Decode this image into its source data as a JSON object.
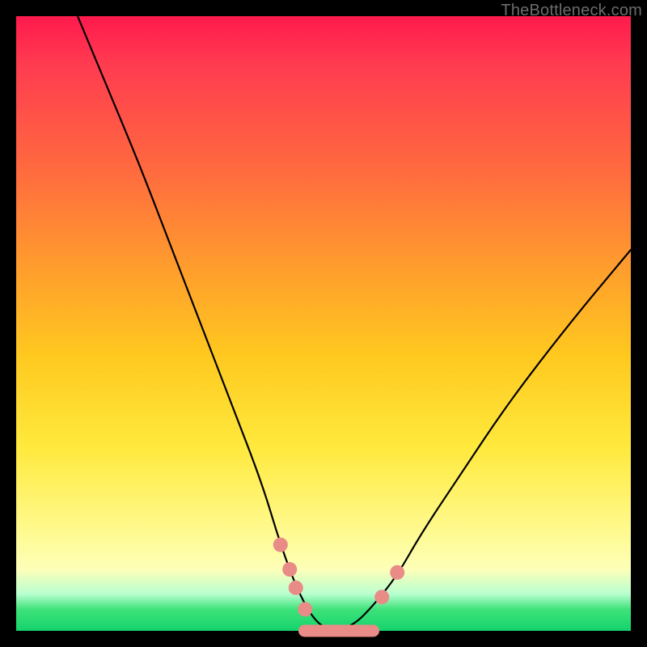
{
  "watermark": "TheBottleneck.com",
  "chart_data": {
    "type": "line",
    "title": "",
    "xlabel": "",
    "ylabel": "",
    "xlim": [
      0,
      100
    ],
    "ylim": [
      0,
      100
    ],
    "series": [
      {
        "name": "bottleneck-curve",
        "x": [
          10,
          15,
          20,
          25,
          30,
          35,
          40,
          43,
          46,
          49,
          52,
          55,
          58,
          62,
          66,
          72,
          80,
          90,
          100
        ],
        "values": [
          100,
          88,
          76,
          63,
          50,
          37,
          24,
          14,
          6,
          1,
          0,
          1,
          4,
          9,
          16,
          25,
          37,
          50,
          62
        ]
      }
    ],
    "markers": [
      {
        "x": 43.0,
        "y": 14.0,
        "shape": "circle"
      },
      {
        "x": 44.5,
        "y": 10.0,
        "shape": "circle"
      },
      {
        "x": 45.5,
        "y": 7.0,
        "shape": "circle"
      },
      {
        "x": 47.0,
        "y": 3.5,
        "shape": "circle"
      },
      {
        "x": 50.0,
        "y": 0.0,
        "shape": "pill"
      },
      {
        "x": 55.0,
        "y": 0.0,
        "shape": "pill"
      },
      {
        "x": 59.5,
        "y": 5.5,
        "shape": "circle"
      },
      {
        "x": 62.0,
        "y": 9.5,
        "shape": "circle"
      }
    ],
    "gradient_stops": [
      {
        "pos": 0.0,
        "color": "#ff1a4d"
      },
      {
        "pos": 0.25,
        "color": "#ff6a3f"
      },
      {
        "pos": 0.55,
        "color": "#ffc81f"
      },
      {
        "pos": 0.83,
        "color": "#fff98a"
      },
      {
        "pos": 0.96,
        "color": "#3fe27a"
      },
      {
        "pos": 1.0,
        "color": "#14d36c"
      }
    ],
    "marker_color": "#e98b87"
  }
}
